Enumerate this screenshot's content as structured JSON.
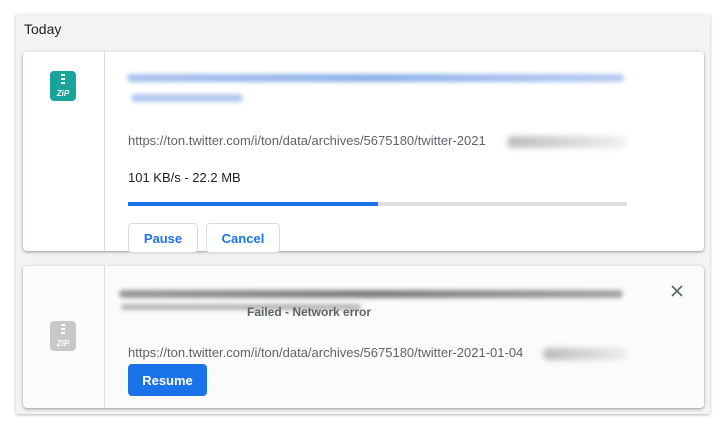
{
  "section": {
    "title": "Today"
  },
  "downloads": [
    {
      "url": "https://ton.twitter.com/i/ton/data/archives/5675180/twitter-2021",
      "speed_text": "101 KB/s - 22.2 MB",
      "progress": 0.5,
      "buttons": {
        "pause": "Pause",
        "cancel": "Cancel"
      },
      "icon": "zip-icon",
      "icon_label": "ZiP",
      "accent": "#1aa39a"
    },
    {
      "url": "https://ton.twitter.com/i/ton/data/archives/5675180/twitter-2021-01-04",
      "status": "Failed - Network error",
      "buttons": {
        "resume": "Resume"
      },
      "icon": "zip-icon",
      "icon_label": "ZiP",
      "accent": "#c8c8c8"
    }
  ],
  "colors": {
    "accent": "#1a73e8",
    "text": "#202124",
    "secondary": "#5f6368"
  }
}
